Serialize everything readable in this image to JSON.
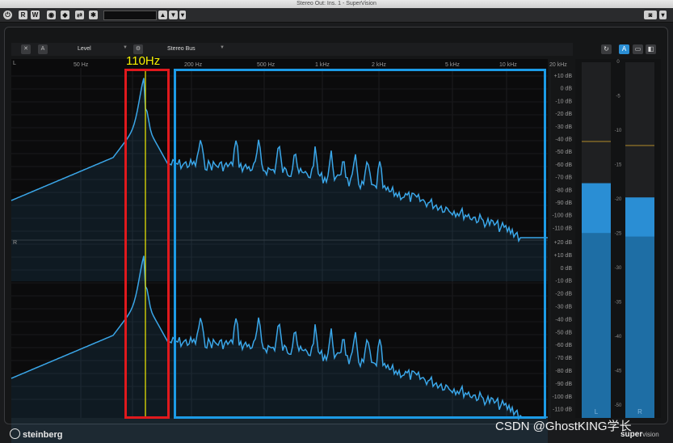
{
  "window_title": "Stereo Out: Ins. 1 - SuperVision",
  "toolbar": {
    "buttons": [
      "R",
      "W"
    ]
  },
  "controls": {
    "bypass_icon": "x-icon",
    "a_label": "A",
    "module": "Level",
    "source": "Stereo Bus"
  },
  "freq_labels": [
    "50 Hz",
    "200 Hz",
    "500 Hz",
    "1 kHz",
    "2 kHz",
    "5 kHz",
    "10 kHz",
    "20 kHz"
  ],
  "db_labels_top": [
    "+10 dB",
    "0 dB",
    "-10 dB",
    "-20 dB",
    "-30 dB",
    "-40 dB",
    "-50 dB",
    "-60 dB",
    "-70 dB",
    "-80 dB",
    "-90 dB",
    "-100 dB",
    "-110 dB"
  ],
  "db_labels_bottom": [
    "+20 dB",
    "+10 dB",
    "0 dB",
    "-10 dB",
    "-20 dB",
    "-30 dB",
    "-40 dB",
    "-50 dB",
    "-60 dB",
    "-70 dB",
    "-80 dB",
    "-90 dB",
    "-100 dB",
    "-110 dB"
  ],
  "channel_top": "L",
  "channel_bottom": "R",
  "annotation": "110Hz",
  "meter_scale": [
    "0",
    "-5",
    "-10",
    "-15",
    "-20",
    "-25",
    "-30",
    "-35",
    "-40",
    "-45",
    "-50"
  ],
  "meter_labels": [
    "L",
    "R"
  ],
  "meter_levels": {
    "L": {
      "peak": 0.66,
      "rms": 0.52
    },
    "R": {
      "peak": 0.62,
      "rms": 0.51
    }
  },
  "footer": {
    "brand": "steinberg",
    "product": "super",
    "product_suffix": "vision"
  },
  "watermark": "CSDN @GhostKING学长",
  "colors": {
    "spectrum": "#3aa6e8",
    "marker_line": "#f4f000",
    "red_box": "#e0191d",
    "blue_box": "#1c9be6",
    "meter": "#2a8ed4"
  }
}
